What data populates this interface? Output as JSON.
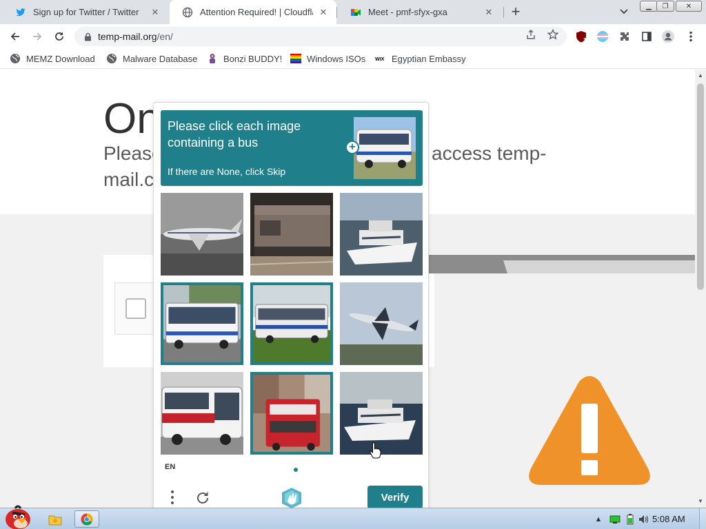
{
  "browser": {
    "tabs": [
      {
        "title": "Sign up for Twitter / Twitter",
        "favicon": "twitter-bird-icon",
        "active": false
      },
      {
        "title": "Attention Required! | Cloudfla",
        "favicon": "globe-icon",
        "active": true
      },
      {
        "title": "Meet - pmf-sfyx-gxa",
        "favicon": "google-meet-icon",
        "active": false
      }
    ],
    "window_controls": {
      "minimize": "▁",
      "restore": "❐",
      "close": "✕"
    },
    "url": {
      "host": "temp-mail.org",
      "path": "/en/"
    },
    "extension_badge": "1",
    "bookmarks": [
      {
        "label": "MEMZ Download",
        "icon": "globe-icon"
      },
      {
        "label": "Malware Database",
        "icon": "globe-icon"
      },
      {
        "label": "Bonzi BUDDY!",
        "icon": "bonzi-icon"
      },
      {
        "label": "Windows ISOs",
        "icon": "rainbow-flag-icon"
      },
      {
        "label": "Egyptian Embassy",
        "icon": "wix-icon"
      }
    ]
  },
  "page": {
    "title_partial": "On",
    "subtitle_left": "Please",
    "subtitle_right": "access temp-",
    "subtitle_line2": "mail.c"
  },
  "captcha": {
    "prompt": "Please click each image containing a bus",
    "skip_hint": "If there are None, click Skip",
    "example_image": "bus",
    "grid": [
      {
        "subject": "airplane",
        "selected": false
      },
      {
        "subject": "train",
        "selected": false
      },
      {
        "subject": "boat",
        "selected": false
      },
      {
        "subject": "bus",
        "selected": true
      },
      {
        "subject": "bus",
        "selected": true
      },
      {
        "subject": "airplane",
        "selected": false
      },
      {
        "subject": "bus",
        "selected": false
      },
      {
        "subject": "bus",
        "selected": true
      },
      {
        "subject": "boat",
        "selected": false
      }
    ],
    "language": "EN",
    "verify_label": "Verify",
    "accent": "#1f7f8a"
  },
  "taskbar": {
    "clock": "5:08 AM",
    "pinned": [
      "angry-bird-start-icon",
      "explorer-folder-icon",
      "chrome-icon"
    ]
  },
  "colors": {
    "warning": "#f0922a",
    "page_grey": "#f1f1f1"
  }
}
